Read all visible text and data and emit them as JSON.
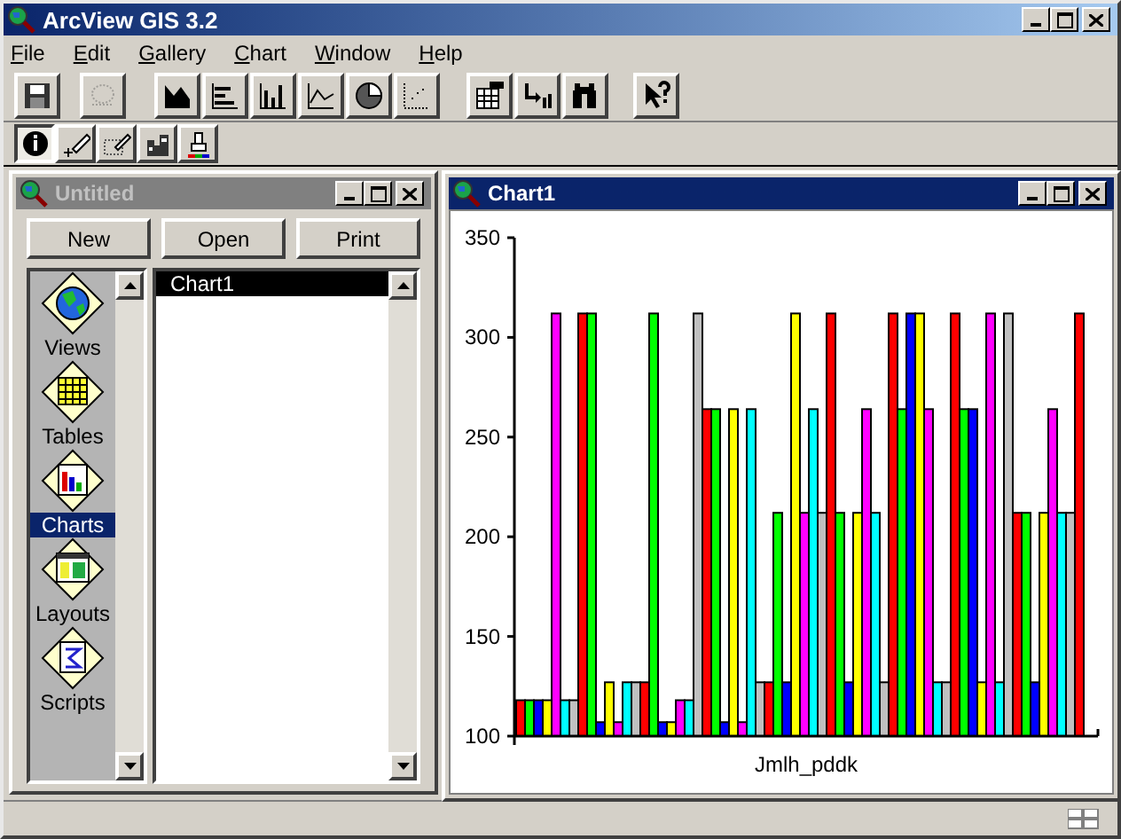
{
  "window": {
    "title": "ArcView GIS 3.2"
  },
  "menu": [
    {
      "label": "File"
    },
    {
      "label": "Edit"
    },
    {
      "label": "Gallery"
    },
    {
      "label": "Chart"
    },
    {
      "label": "Window"
    },
    {
      "label": "Help"
    }
  ],
  "toolbar": [
    {
      "disabled": false
    },
    {
      "disabled": true
    },
    {
      "disabled": false
    },
    {
      "disabled": false
    },
    {
      "disabled": false
    },
    {
      "disabled": false
    },
    {
      "disabled": false
    },
    {
      "disabled": false
    },
    {
      "disabled": false
    },
    {
      "disabled": false
    },
    {
      "disabled": false
    },
    {
      "disabled": false
    }
  ],
  "tools": [
    {
      "selected": true
    },
    {
      "selected": false
    },
    {
      "selected": false
    },
    {
      "selected": false
    },
    {
      "selected": false
    }
  ],
  "project_window": {
    "title": "Untitled",
    "active": false,
    "buttons": [
      "New",
      "Open",
      "Print"
    ],
    "doc_types": [
      {
        "label": "Views",
        "selected": false
      },
      {
        "label": "Tables",
        "selected": false
      },
      {
        "label": "Charts",
        "selected": true
      },
      {
        "label": "Layouts",
        "selected": false
      },
      {
        "label": "Scripts",
        "selected": false
      }
    ],
    "documents": [
      {
        "label": "Chart1",
        "selected": true
      }
    ]
  },
  "chart_window": {
    "title": "Chart1",
    "active": true,
    "chart_data": {
      "type": "bar",
      "categories": [
        "Jmlh_pddk"
      ],
      "ylim": [
        100,
        350
      ],
      "yticks": [
        100,
        150,
        200,
        250,
        300,
        350
      ],
      "series": [
        {
          "color": "#ff0000",
          "values": [
            118
          ]
        },
        {
          "color": "#00ff00",
          "values": [
            118
          ]
        },
        {
          "color": "#0000ff",
          "values": [
            118
          ]
        },
        {
          "color": "#ffff00",
          "values": [
            118
          ]
        },
        {
          "color": "#ff00ff",
          "values": [
            312
          ]
        },
        {
          "color": "#00ffff",
          "values": [
            118
          ]
        },
        {
          "color": "#c0c0c0",
          "values": [
            118
          ]
        },
        {
          "color": "#ff0000",
          "values": [
            312
          ]
        },
        {
          "color": "#00ff00",
          "values": [
            312
          ]
        },
        {
          "color": "#0000ff",
          "values": [
            107
          ]
        },
        {
          "color": "#ffff00",
          "values": [
            127
          ]
        },
        {
          "color": "#ff00ff",
          "values": [
            107
          ]
        },
        {
          "color": "#00ffff",
          "values": [
            127
          ]
        },
        {
          "color": "#c0c0c0",
          "values": [
            127
          ]
        },
        {
          "color": "#ff0000",
          "values": [
            127
          ]
        },
        {
          "color": "#00ff00",
          "values": [
            312
          ]
        },
        {
          "color": "#0000ff",
          "values": [
            107
          ]
        },
        {
          "color": "#ffff00",
          "values": [
            107
          ]
        },
        {
          "color": "#ff00ff",
          "values": [
            118
          ]
        },
        {
          "color": "#00ffff",
          "values": [
            118
          ]
        },
        {
          "color": "#c0c0c0",
          "values": [
            312
          ]
        },
        {
          "color": "#ff0000",
          "values": [
            264
          ]
        },
        {
          "color": "#00ff00",
          "values": [
            264
          ]
        },
        {
          "color": "#0000ff",
          "values": [
            107
          ]
        },
        {
          "color": "#ffff00",
          "values": [
            264
          ]
        },
        {
          "color": "#ff00ff",
          "values": [
            107
          ]
        },
        {
          "color": "#00ffff",
          "values": [
            264
          ]
        },
        {
          "color": "#c0c0c0",
          "values": [
            127
          ]
        },
        {
          "color": "#ff0000",
          "values": [
            127
          ]
        },
        {
          "color": "#00ff00",
          "values": [
            212
          ]
        },
        {
          "color": "#0000ff",
          "values": [
            127
          ]
        },
        {
          "color": "#ffff00",
          "values": [
            312
          ]
        },
        {
          "color": "#ff00ff",
          "values": [
            212
          ]
        },
        {
          "color": "#00ffff",
          "values": [
            264
          ]
        },
        {
          "color": "#c0c0c0",
          "values": [
            212
          ]
        },
        {
          "color": "#ff0000",
          "values": [
            312
          ]
        },
        {
          "color": "#00ff00",
          "values": [
            212
          ]
        },
        {
          "color": "#0000ff",
          "values": [
            127
          ]
        },
        {
          "color": "#ffff00",
          "values": [
            212
          ]
        },
        {
          "color": "#ff00ff",
          "values": [
            264
          ]
        },
        {
          "color": "#00ffff",
          "values": [
            212
          ]
        },
        {
          "color": "#c0c0c0",
          "values": [
            127
          ]
        },
        {
          "color": "#ff0000",
          "values": [
            312
          ]
        },
        {
          "color": "#00ff00",
          "values": [
            264
          ]
        },
        {
          "color": "#0000ff",
          "values": [
            312
          ]
        },
        {
          "color": "#ffff00",
          "values": [
            312
          ]
        },
        {
          "color": "#ff00ff",
          "values": [
            264
          ]
        },
        {
          "color": "#00ffff",
          "values": [
            127
          ]
        },
        {
          "color": "#c0c0c0",
          "values": [
            127
          ]
        },
        {
          "color": "#ff0000",
          "values": [
            312
          ]
        },
        {
          "color": "#00ff00",
          "values": [
            264
          ]
        },
        {
          "color": "#0000ff",
          "values": [
            264
          ]
        },
        {
          "color": "#ffff00",
          "values": [
            127
          ]
        },
        {
          "color": "#ff00ff",
          "values": [
            312
          ]
        },
        {
          "color": "#00ffff",
          "values": [
            127
          ]
        },
        {
          "color": "#c0c0c0",
          "values": [
            312
          ]
        },
        {
          "color": "#ff0000",
          "values": [
            212
          ]
        },
        {
          "color": "#00ff00",
          "values": [
            212
          ]
        },
        {
          "color": "#0000ff",
          "values": [
            127
          ]
        },
        {
          "color": "#ffff00",
          "values": [
            212
          ]
        },
        {
          "color": "#ff00ff",
          "values": [
            264
          ]
        },
        {
          "color": "#00ffff",
          "values": [
            212
          ]
        },
        {
          "color": "#c0c0c0",
          "values": [
            212
          ]
        },
        {
          "color": "#ff0000",
          "values": [
            312
          ]
        }
      ]
    }
  }
}
